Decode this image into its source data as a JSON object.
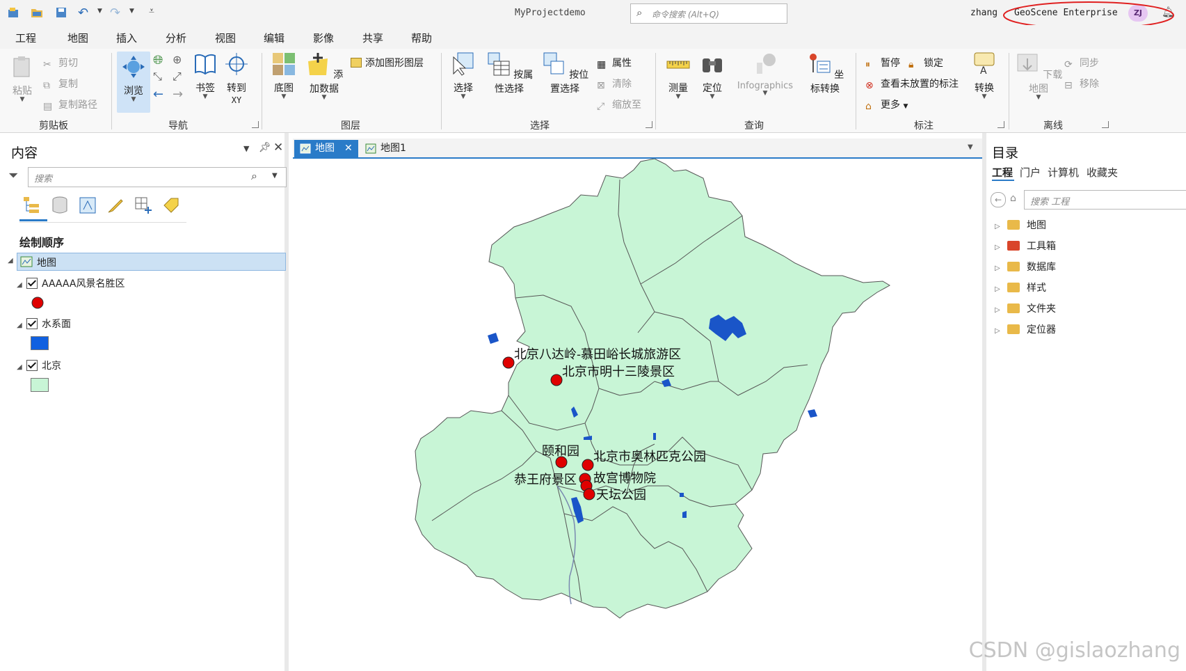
{
  "titlebar": {
    "project": "MyProjectdemo",
    "command_search_placeholder": "命令搜索 (Alt+Q)",
    "user": "zhang",
    "portal": "GeoScene Enterprise",
    "avatar_initials": "ZJ"
  },
  "ribbon_tabs": [
    "工程",
    "地图",
    "插入",
    "分析",
    "视图",
    "编辑",
    "影像",
    "共享",
    "帮助"
  ],
  "active_tab": "地图",
  "ribbon": {
    "clipboard": {
      "label": "剪贴板",
      "paste": "粘贴",
      "cut": "剪切",
      "copy": "复制",
      "copy_path": "复制路径"
    },
    "navigate": {
      "label": "导航",
      "explore": "浏览",
      "bookmarks": "书签",
      "goto": "转到",
      "goto2": "XY"
    },
    "layer": {
      "label": "图层",
      "basemap": "底图",
      "add_data": "添加数据",
      "add_graphics": "添加图形图层"
    },
    "selection": {
      "label": "选择",
      "select": "选择",
      "by_attr": "按属性选择",
      "by_loc": "按位置选择",
      "attributes": "属性",
      "clear": "清除",
      "zoom_to": "缩放至"
    },
    "inquiry": {
      "label": "查询",
      "measure": "测量",
      "locate": "定位",
      "infographics": "Infographics",
      "convert": "坐标转换"
    },
    "labeling": {
      "label": "标注",
      "pause": "暂停",
      "lock": "锁定",
      "view_unplaced": "查看未放置的标注",
      "more": "更多",
      "convert": "转换"
    },
    "offline": {
      "label": "离线",
      "download": "下载地图",
      "sync": "同步",
      "remove": "移除"
    }
  },
  "contents": {
    "title": "内容",
    "search_placeholder": "搜索",
    "drawing_order": "绘制顺序",
    "map": "地图",
    "layers": [
      {
        "name": "AAAAA风景名胜区",
        "symbol": "#e00000"
      },
      {
        "name": "水系面",
        "symbol": "#1060e0"
      },
      {
        "name": "北京",
        "symbol": "#c8f5d6"
      }
    ]
  },
  "map_tabs": [
    "地图",
    "地图1"
  ],
  "map": {
    "fill": "#c8f5d6",
    "water": "#1a55c8",
    "poi_color": "#e00000",
    "labels": [
      "北京八达岭-慕田峪长城旅游区",
      "北京市明十三陵景区",
      "颐和园",
      "北京市奥林匹克公园",
      "恭王府景区",
      "故宫博物院",
      "天坛公园"
    ]
  },
  "catalog": {
    "title": "目录",
    "tabs": [
      "工程",
      "门户",
      "计算机",
      "收藏夹"
    ],
    "search_placeholder": "搜索 工程",
    "items": [
      "地图",
      "工具箱",
      "数据库",
      "样式",
      "文件夹",
      "定位器"
    ]
  },
  "watermark": "CSDN @gislaozhang"
}
